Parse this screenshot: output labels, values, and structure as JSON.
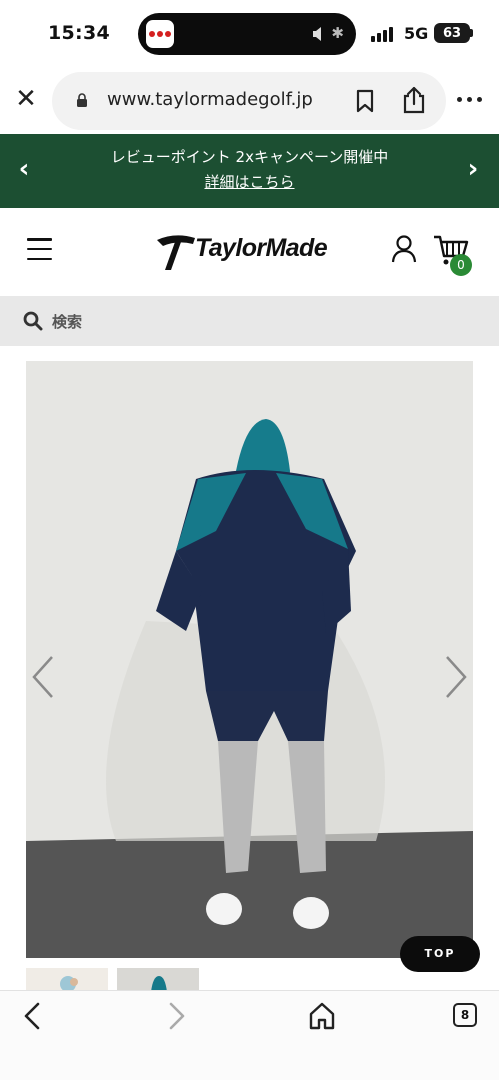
{
  "status_bar": {
    "time": "15:34",
    "network": "5G",
    "battery": "63",
    "icons": [
      "signal-icon",
      "mute-icon",
      "bluetooth-icon",
      "battery-icon"
    ]
  },
  "browser": {
    "url": "www.taylormadegolf.jp",
    "icons": [
      "close-icon",
      "lock-icon",
      "bookmark-icon",
      "share-icon",
      "more-icon"
    ]
  },
  "banner": {
    "text": "レビューポイント 2xキャンペーン開催中",
    "link": "詳細はこちら",
    "background": "#1c4f32"
  },
  "header": {
    "logo_text": "TaylorMade",
    "cart_count": "0",
    "badge_color": "#2a8a35"
  },
  "search": {
    "placeholder": "検索"
  },
  "gallery": {
    "top_label": "TOP",
    "image_subject": "back view of person in navy/teal hoodie and navy/grey jogger pants",
    "thumbnail_count": 2
  },
  "toolbar": {
    "tab_count": "8",
    "icons": [
      "back-icon",
      "forward-icon",
      "home-icon",
      "tabs-icon"
    ]
  }
}
